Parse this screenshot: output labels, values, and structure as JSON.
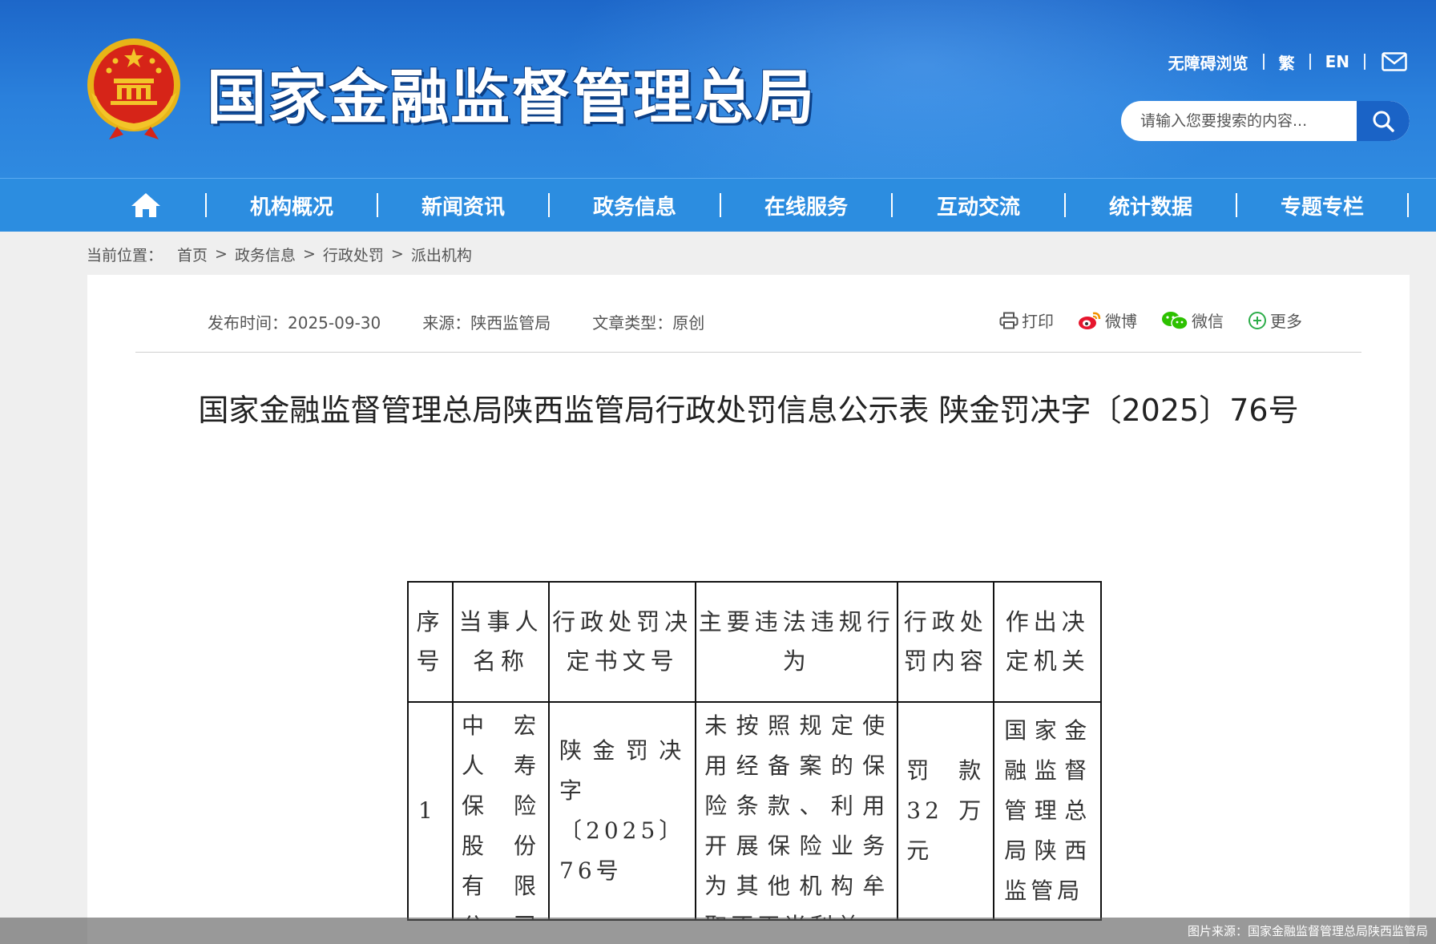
{
  "header": {
    "site_title": "国家金融监督管理总局",
    "top_links": [
      "无障碍浏览",
      "繁",
      "EN"
    ],
    "mail_icon": "mail-icon",
    "search": {
      "placeholder": "请输入您要搜索的内容..."
    }
  },
  "nav": {
    "home_icon": "home-icon",
    "items": [
      "机构概况",
      "新闻资讯",
      "政务信息",
      "在线服务",
      "互动交流",
      "统计数据",
      "专题专栏"
    ]
  },
  "breadcrumb": {
    "label": "当前位置：",
    "items": [
      "首页",
      "政务信息",
      "行政处罚",
      "派出机构"
    ],
    "separator": ">"
  },
  "article": {
    "publish_time": "发布时间：2025-09-30",
    "source": "来源：陕西监管局",
    "type": "文章类型：原创",
    "share": {
      "print": "打印",
      "weibo": "微博",
      "wechat": "微信",
      "more": "更多"
    },
    "title": "国家金融监督管理总局陕西监管局行政处罚信息公示表 陕金罚决字〔2025〕76号"
  },
  "table": {
    "headers": [
      "序号",
      "当事人名称",
      "行政处罚决定书文号",
      "主要违法违规行为",
      "行政处罚内容",
      "作出决定机关"
    ],
    "rows": [
      {
        "no": "1",
        "name": "中宏人寿保险股份有限公司陕西分公司",
        "doc": "陕金罚决字〔2025〕76号",
        "act": "未按照规定使用经备案的保险条款、利用开展保险业务为其他机构牟取不正当利益",
        "penalty": "罚款32万元",
        "org": "国家金融监督管理总局陕西监管局"
      }
    ]
  },
  "caption": "图片来源：国家金融监督管理总局陕西监管局",
  "colors": {
    "header_blue": "#2a80dc",
    "nav_blue": "#2c8de0",
    "search_btn": "#1a63c6"
  }
}
